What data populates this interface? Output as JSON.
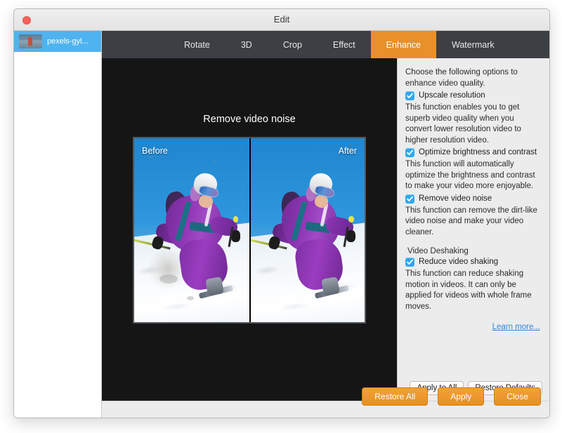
{
  "window": {
    "title": "Edit",
    "close_tooltip": "Close"
  },
  "sidebar": {
    "files": [
      {
        "name": "pexels-gyl...",
        "selected": true
      }
    ]
  },
  "tabs": [
    {
      "label": "Rotate",
      "active": false
    },
    {
      "label": "3D",
      "active": false
    },
    {
      "label": "Crop",
      "active": false
    },
    {
      "label": "Effect",
      "active": false
    },
    {
      "label": "Enhance",
      "active": true
    },
    {
      "label": "Watermark",
      "active": false
    }
  ],
  "preview": {
    "title": "Remove video noise",
    "before_label": "Before",
    "after_label": "After"
  },
  "options": {
    "lead_text": "Choose the following options to enhance video quality.",
    "items": [
      {
        "label": "Upscale resolution",
        "checked": true,
        "description": "This function enables you to get superb video quality when you convert lower resolution video to higher resolution video."
      },
      {
        "label": "Optimize brightness and contrast",
        "checked": true,
        "description": "This function will automatically optimize the brightness and contrast to make your video more enjoyable."
      },
      {
        "label": "Remove video noise",
        "checked": true,
        "description": "This function can remove the dirt-like video noise and make your video cleaner."
      }
    ],
    "group": {
      "title": "Video Deshaking",
      "item": {
        "label": "Reduce video shaking",
        "checked": true,
        "description": "This function can reduce shaking motion in videos. It can only be applied for videos with whole frame moves."
      }
    },
    "learn_more": "Learn more...",
    "apply_to_all": "Apply to All",
    "restore_defaults": "Restore Defaults"
  },
  "footer": {
    "restore_all": "Restore All",
    "apply": "Apply",
    "close": "Close"
  },
  "colors": {
    "accent_orange": "#e8912a",
    "checkbox_blue": "#2fa9ee",
    "selection_blue": "#4fb3ef",
    "link_blue": "#2f86d8",
    "tabbar_dark": "#3c3f43",
    "stage_dark": "#151515"
  }
}
